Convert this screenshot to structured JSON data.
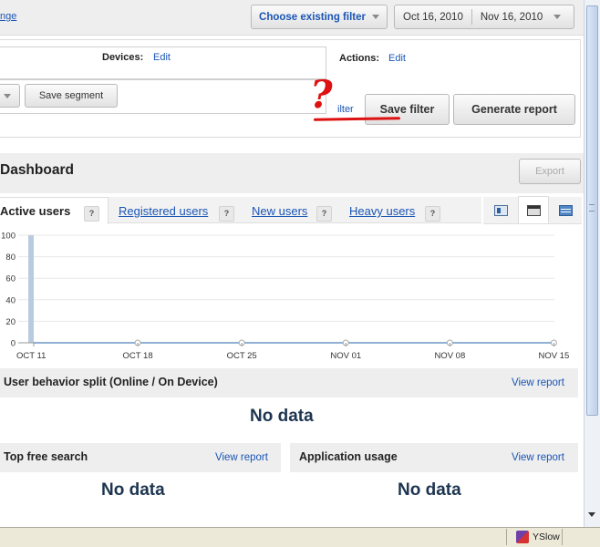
{
  "header": {
    "left_link": "nge",
    "filter_select": "Choose existing filter",
    "date_start": "Oct 16, 2010",
    "date_end": "Nov 16, 2010"
  },
  "segment": {
    "devices_label": "Devices:",
    "devices_edit": "Edit",
    "actions_label": "Actions:",
    "actions_edit": "Edit",
    "save_segment": "Save segment",
    "partial_link": "ilter",
    "save_filter": "Save filter",
    "generate_report": "Generate report"
  },
  "annotation": {
    "mark": "?",
    "color": "#dd1111"
  },
  "dashboard": {
    "title": "Dashboard",
    "export": "Export"
  },
  "tabs": [
    {
      "label": "Active users",
      "help": "?"
    },
    {
      "label": "Registered users",
      "help": "?"
    },
    {
      "label": "New users",
      "help": "?"
    },
    {
      "label": "Heavy users",
      "help": "?"
    }
  ],
  "view_icons": [
    "list-view-icon",
    "table-view-icon",
    "chart-view-icon"
  ],
  "chart_data": {
    "type": "line",
    "x_ticks": [
      "OCT 11",
      "OCT 18",
      "OCT 25",
      "NOV 01",
      "NOV 08",
      "NOV 15"
    ],
    "y_ticks": [
      "100",
      "80",
      "60",
      "40",
      "20",
      "0"
    ],
    "ylim": [
      0,
      100
    ],
    "series": [
      {
        "values": [
          0,
          0,
          0,
          0,
          0,
          0
        ],
        "color": "#6b96c6"
      }
    ],
    "highlight_bar": {
      "x": "OCT 11",
      "value": 100,
      "color": "#b9cbe0"
    },
    "grid": true
  },
  "sections": {
    "split_title": "User behavior split (Online / On Device)",
    "split_view": "View report",
    "split_nodata": "No data",
    "free_search_title": "Top free search",
    "free_search_view": "View report",
    "free_search_nodata": "No data",
    "app_usage_title": "Application usage",
    "app_usage_view": "View report",
    "app_usage_nodata": "No data"
  },
  "statusbar": {
    "yslow": "YSlow"
  }
}
